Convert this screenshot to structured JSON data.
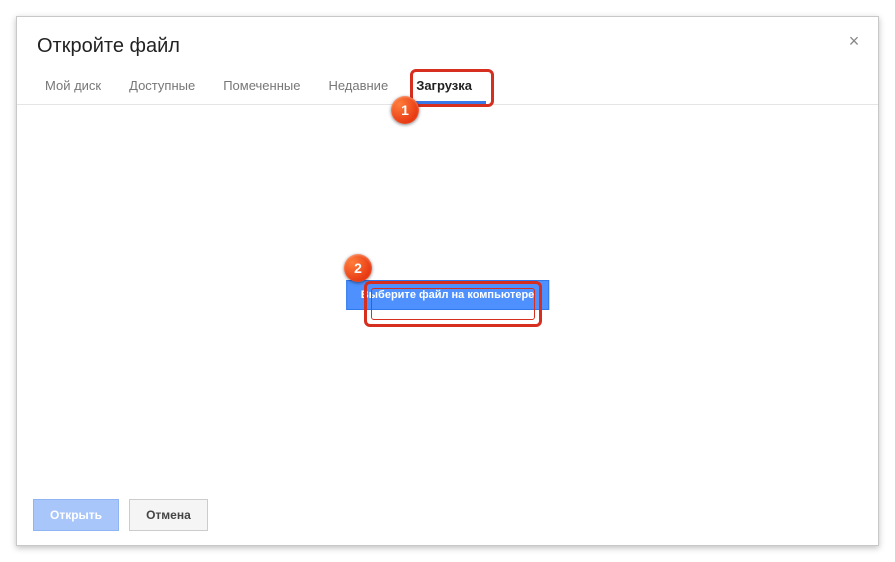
{
  "dialog": {
    "title": "Откройте файл",
    "close_label": "×"
  },
  "tabs": [
    {
      "label": "Мой диск"
    },
    {
      "label": "Доступные"
    },
    {
      "label": "Помеченные"
    },
    {
      "label": "Недавние"
    },
    {
      "label": "Загрузка",
      "active": true
    }
  ],
  "upload": {
    "button_label": "Выберите файл на компьютере"
  },
  "footer": {
    "open_label": "Открыть",
    "cancel_label": "Отмена"
  },
  "annotations": {
    "badge1": "1",
    "badge2": "2"
  }
}
